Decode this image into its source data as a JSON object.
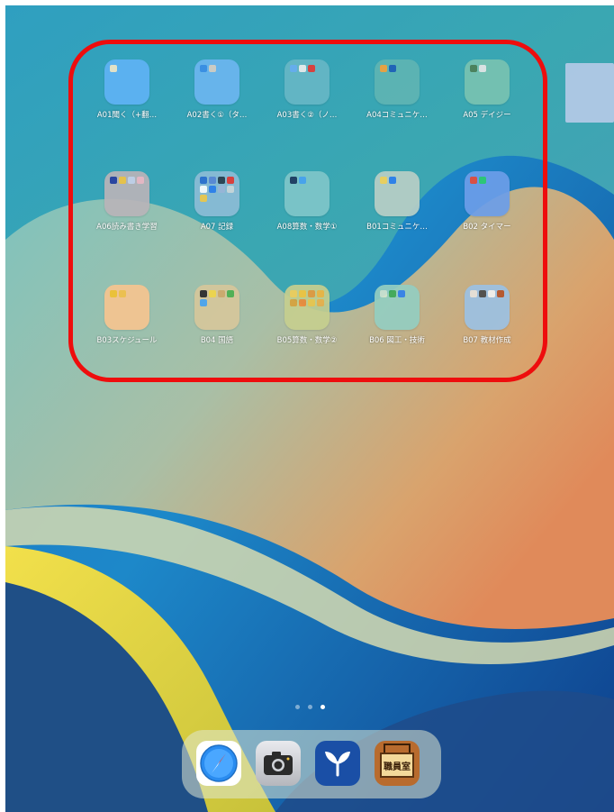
{
  "home_screen": {
    "folders": [
      {
        "id": "a01",
        "label": "A01聞く（+翻…",
        "tile_color": "#5fb3f5",
        "mini_icons": [
          "#f1e7c9"
        ]
      },
      {
        "id": "a02",
        "label": "A02書く①（タ…",
        "tile_color": "#6cb6f0",
        "mini_icons": [
          "#3b8ee6",
          "#d7cfc5"
        ]
      },
      {
        "id": "a03",
        "label": "A03書く②（ノ…",
        "tile_color": "#66b7c6",
        "mini_icons": [
          "#6aaef1",
          "#eeeeee",
          "#e53935"
        ]
      },
      {
        "id": "a04",
        "label": "A04コミュニケ…",
        "tile_color": "#5fb5b3",
        "mini_icons": [
          "#f4a23b",
          "#1f5fb8"
        ]
      },
      {
        "id": "a05",
        "label": "A05 デイジー",
        "tile_color": "#78c3b1",
        "mini_icons": [
          "#4d7f56",
          "#e7e7e7"
        ]
      },
      {
        "id": "a06",
        "label": "A06読み書き学習",
        "tile_color": "#b9b4b9",
        "mini_icons": [
          "#2a3f9e",
          "#f4c542",
          "#c9d2e9",
          "#f2b9c5"
        ]
      },
      {
        "id": "a07",
        "label": "A07 記録",
        "tile_color": "#8cbcd6",
        "mini_icons": [
          "#2e6fcf",
          "#5c88d6",
          "#2a3e4f",
          "#e53935",
          "#ffffff",
          "#2f80ed",
          "#9fb7d9",
          "#cfd8dc",
          "#f2c94c"
        ]
      },
      {
        "id": "a08",
        "label": "A08算数・数学①",
        "tile_color": "#7fc6c9",
        "mini_icons": [
          "#1f3a5f",
          "#4aa3f0"
        ]
      },
      {
        "id": "b01",
        "label": "B01コミュニケ…",
        "tile_color": "#b8cfc6",
        "mini_icons": [
          "#f6d35a",
          "#2f80ed"
        ]
      },
      {
        "id": "b02",
        "label": "B02 タイマー",
        "tile_color": "#6c9ee9",
        "mini_icons": [
          "#e74c3c",
          "#2ecc71"
        ]
      },
      {
        "id": "b03",
        "label": "B03スケジュール",
        "tile_color": "#f6c590",
        "mini_icons": [
          "#f2c230",
          "#f3c04a"
        ]
      },
      {
        "id": "b04",
        "label": "B04 国語",
        "tile_color": "#d6c79b",
        "mini_icons": [
          "#2b2b2b",
          "#f2d648",
          "#cfa96b",
          "#4caf50",
          "#4aa3f0"
        ]
      },
      {
        "id": "b05",
        "label": "B05算数・数学②",
        "tile_color": "#c6cf8f",
        "mini_icons": [
          "#f6d05a",
          "#f7c63d",
          "#e89b3c",
          "#f4b73f",
          "#d7a23d",
          "#f28c38",
          "#f2c84b",
          "#f0b348"
        ]
      },
      {
        "id": "b06",
        "label": "B06 図工・技術",
        "tile_color": "#94cec1",
        "mini_icons": [
          "#d4e6cf",
          "#3caa57",
          "#2f80ed"
        ]
      },
      {
        "id": "b07",
        "label": "B07 教材作成",
        "tile_color": "#9cc1e3",
        "mini_icons": [
          "#e7e3dd",
          "#4a4a4a",
          "#f2f2f2",
          "#b4542b"
        ]
      }
    ]
  },
  "page_indicator": {
    "count": 3,
    "active": 2
  },
  "dock": {
    "apps": [
      {
        "name": "safari-app-icon"
      },
      {
        "name": "camera-app-icon"
      },
      {
        "name": "sprout-app-icon"
      },
      {
        "name": "staffroom-app-icon",
        "sign_text": "職員室"
      }
    ]
  },
  "annotation": {
    "highlight_color": "#ee0d0d"
  }
}
